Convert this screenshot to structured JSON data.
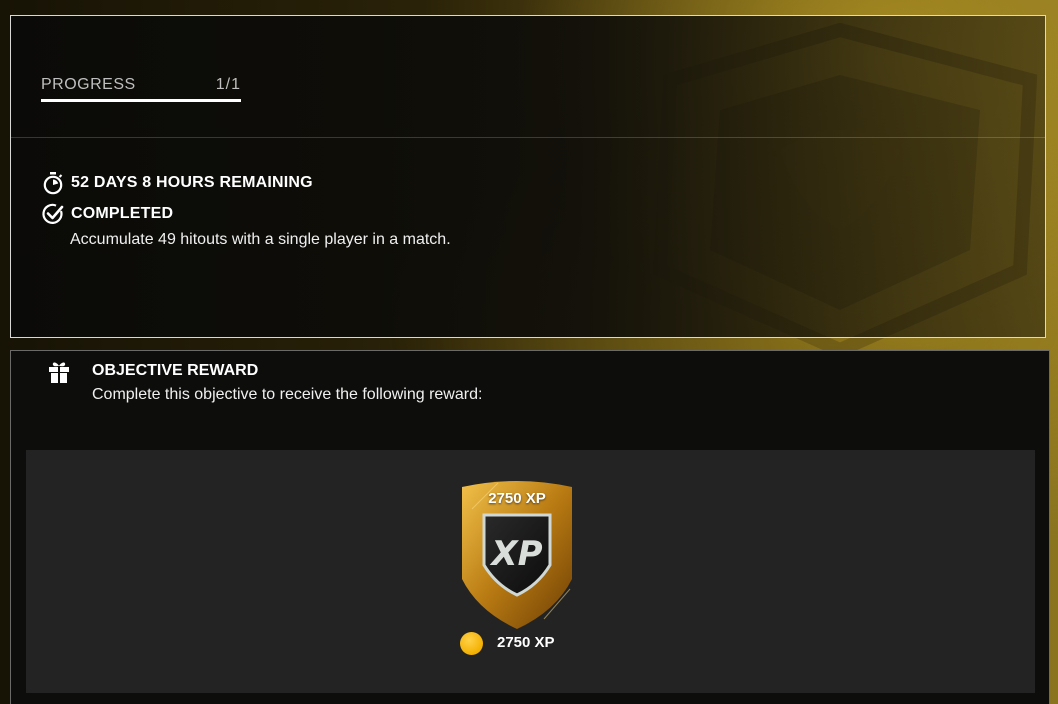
{
  "progress": {
    "label": "PROGRESS",
    "value_text": "1/1",
    "fraction": 1.0
  },
  "objective": {
    "timer_icon": "stopwatch-icon",
    "time_remaining": "52 DAYS 8 HOURS REMAINING",
    "status_icon": "check-circle-icon",
    "status": "COMPLETED",
    "description": "Accumulate 49 hitouts with a single player in a match."
  },
  "reward": {
    "icon": "gift-icon",
    "title": "OBJECTIVE REWARD",
    "subtitle": "Complete this objective to receive the following reward:",
    "badge_label": "2750 XP",
    "badge_icon": "xp-shield-icon",
    "currency_icon": "coin-icon",
    "amount_text": "2750 XP"
  },
  "colors": {
    "accent_gold": "#f4b000",
    "panel_border": "#d8d8d8"
  }
}
